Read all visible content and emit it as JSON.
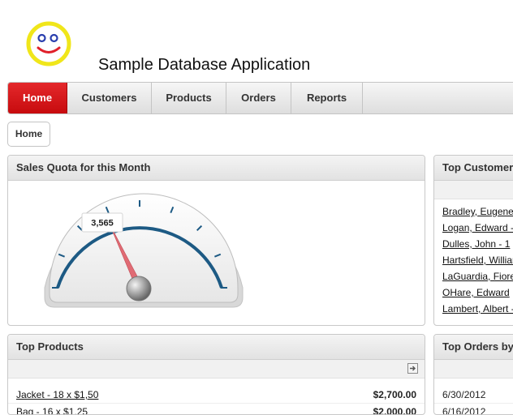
{
  "app": {
    "title": "Sample Database Application",
    "logo_icon": "smiley-face-icon"
  },
  "tabs": [
    {
      "label": "Home",
      "active": true
    },
    {
      "label": "Customers",
      "active": false
    },
    {
      "label": "Products",
      "active": false
    },
    {
      "label": "Orders",
      "active": false
    },
    {
      "label": "Reports",
      "active": false
    }
  ],
  "breadcrumb": {
    "label": "Home"
  },
  "sales_quota": {
    "title": "Sales Quota for this Month",
    "value_label": "3,565",
    "needle_fraction": 0.36
  },
  "top_customers": {
    "title": "Top Customers",
    "items": [
      "Bradley, Eugene",
      "Logan, Edward -",
      "Dulles, John - 1",
      "Hartsfield, William",
      "LaGuardia, Fiore",
      "OHare, Edward",
      "Lambert, Albert -"
    ]
  },
  "top_products": {
    "title": "Top Products",
    "export_icon": "export-arrow-icon",
    "rows": [
      {
        "name": "Jacket - 18 x $1,50",
        "total": "$2,700.00"
      },
      {
        "name": "Bag - 16 x $1,25",
        "total": "$2,000.00"
      }
    ]
  },
  "top_orders": {
    "title": "Top Orders by",
    "rows": [
      "6/30/2012",
      "6/16/2012"
    ]
  },
  "colors": {
    "accent_red": "#d8191c",
    "gauge_arc": "#1d5a84",
    "needle": "#e06b74"
  }
}
